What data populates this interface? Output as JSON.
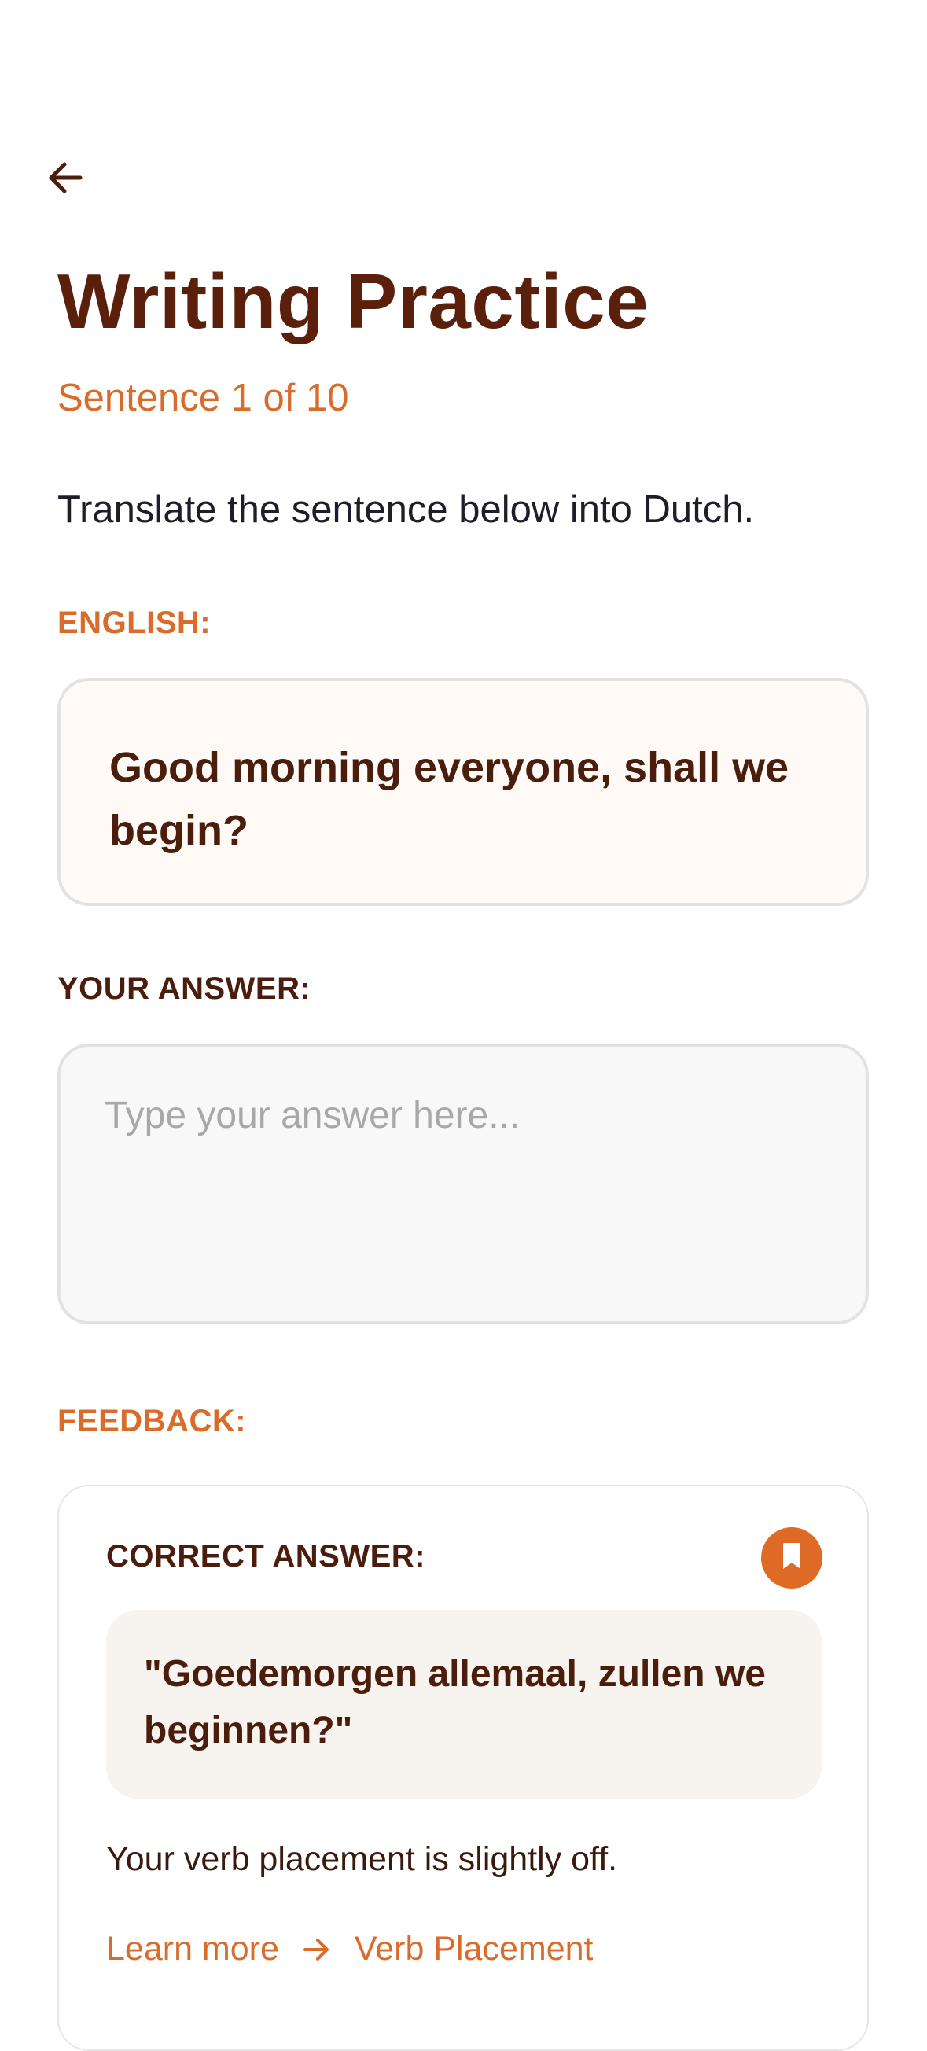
{
  "header": {
    "back_icon": "arrow-left-icon",
    "title": "Writing Practice",
    "progress": "Sentence 1 of 10"
  },
  "instruction": "Translate the sentence below into Dutch.",
  "english": {
    "label": "ENGLISH:",
    "sentence": "Good morning everyone, shall we begin?"
  },
  "answer": {
    "label": "YOUR ANSWER:",
    "value": "",
    "placeholder": "Type your answer here..."
  },
  "feedback": {
    "label": "FEEDBACK:",
    "correct_label": "CORRECT ANSWER:",
    "bookmark_icon": "bookmark-icon",
    "correct_answer": "\"Goedemorgen allemaal, zullen we beginnen?\"",
    "message": "Your verb placement is slightly off.",
    "learn_more": "Learn more",
    "topic": "Verb Placement"
  },
  "colors": {
    "accent": "#de6a26",
    "title": "#5b200c",
    "text_dark": "#4a1d0c"
  }
}
